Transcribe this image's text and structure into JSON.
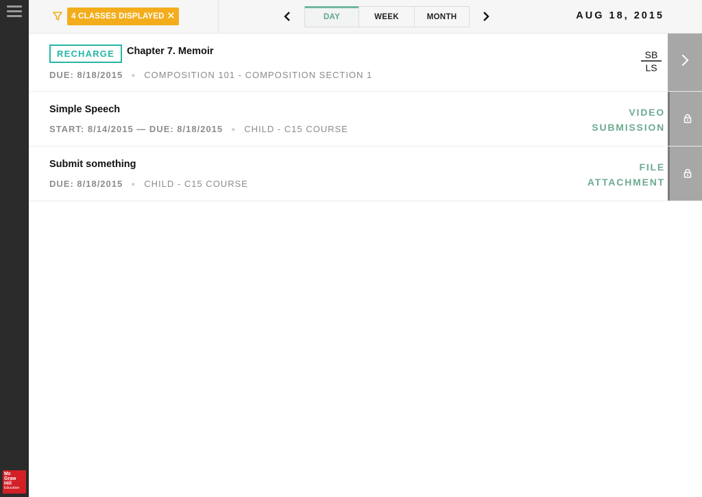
{
  "header": {
    "filter_chip_label": "4 CLASSES DISPLAYED",
    "filter_chip_close": "✕",
    "prev_label": "‹",
    "next_label": "›",
    "tabs": [
      {
        "label": "DAY",
        "active": true
      },
      {
        "label": "WEEK",
        "active": false
      },
      {
        "label": "MONTH",
        "active": false
      }
    ],
    "date": "AUG 18, 2015"
  },
  "assignments": [
    {
      "badge": "RECHARGE",
      "title": "Chapter 7. Memoir",
      "dates": "DUE: 8/18/2015",
      "course": "COMPOSITION 101 - COMPOSITION SECTION 1",
      "type_line1": "",
      "type_line2": "",
      "logo_top": "SB",
      "logo_bottom": "LS",
      "action": "chevron-right-icon"
    },
    {
      "title": "Simple Speech",
      "dates": "START: 8/14/2015 — DUE: 8/18/2015",
      "course": "CHILD - C15 COURSE",
      "type_line1": "VIDEO",
      "type_line2": "SUBMISSION",
      "action": "lock-icon"
    },
    {
      "title": "Submit something",
      "dates": "DUE: 8/18/2015",
      "course": "CHILD - C15 COURSE",
      "type_line1": "FILE",
      "type_line2": "ATTACHMENT",
      "action": "lock-icon"
    }
  ],
  "brand": {
    "line1": "Mc",
    "line2": "Graw",
    "line3": "Hill",
    "line4": "Education"
  },
  "colors": {
    "filter_chip": "#f3ad1c",
    "accent_teal": "#26b5a6",
    "type_label_green": "#6daa90",
    "sidebar": "#2b2b2b",
    "side_button": "#a7a7a7",
    "logo_red": "#d32027"
  }
}
